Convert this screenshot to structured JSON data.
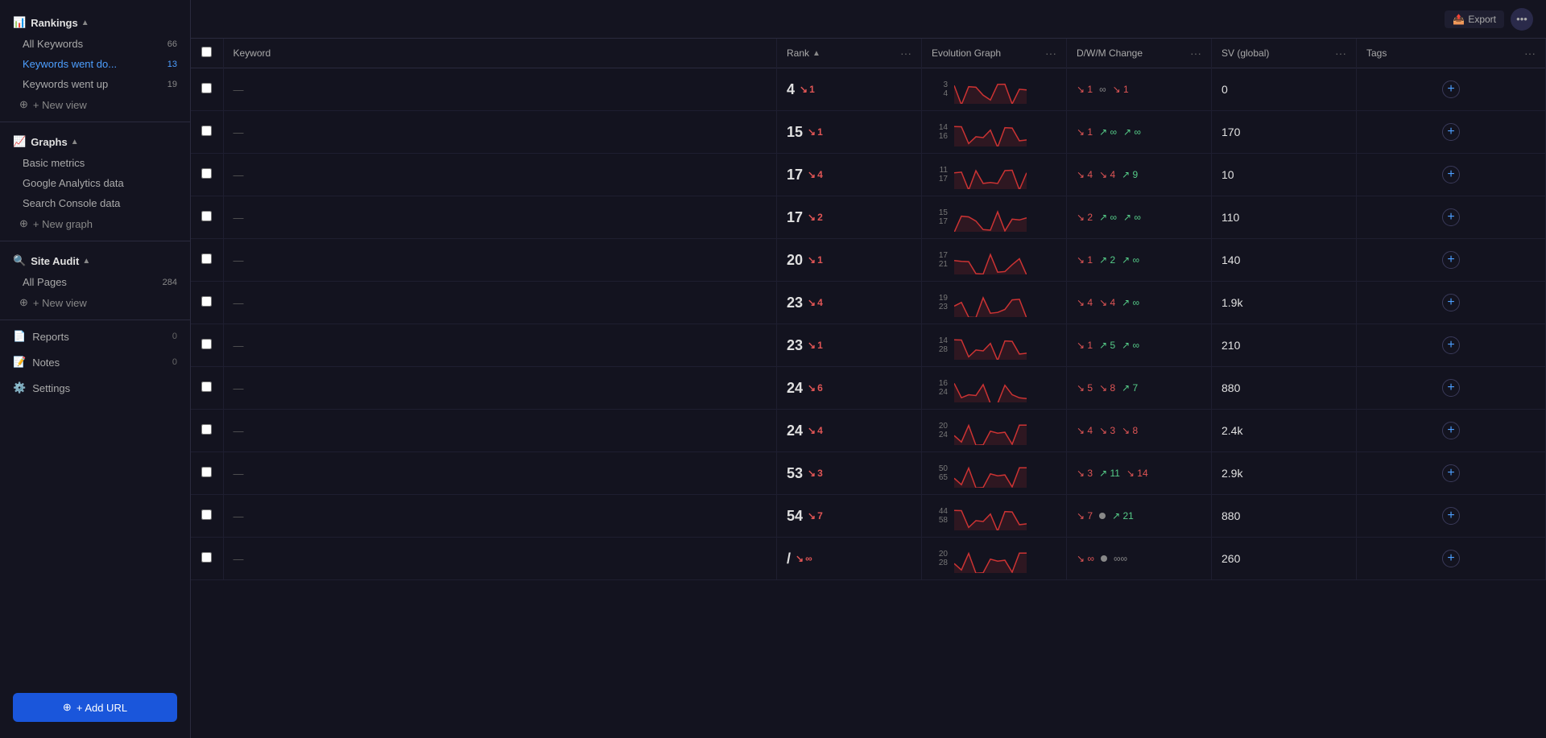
{
  "sidebar": {
    "rankings_label": "Rankings",
    "all_keywords_label": "All Keywords",
    "all_keywords_count": "66",
    "keywords_went_down_label": "Keywords went do...",
    "keywords_went_down_count": "13",
    "keywords_went_up_label": "Keywords went up",
    "keywords_went_up_count": "19",
    "new_view_label1": "+ New view",
    "graphs_label": "Graphs",
    "basic_metrics_label": "Basic metrics",
    "google_analytics_label": "Google Analytics data",
    "search_console_label": "Search Console data",
    "new_graph_label": "+ New graph",
    "site_audit_label": "Site Audit",
    "all_pages_label": "All Pages",
    "all_pages_count": "284",
    "new_view_label2": "+ New view",
    "reports_label": "Reports",
    "reports_count": "0",
    "notes_label": "Notes",
    "notes_count": "0",
    "settings_label": "Settings",
    "add_url_label": "+ Add URL"
  },
  "table": {
    "columns": {
      "rank": "Rank",
      "evolution": "Evolution Graph",
      "dwm": "D/W/M Change",
      "sv": "SV (global)",
      "tags": "Tags"
    },
    "rows": [
      {
        "id": 1,
        "rank": "4",
        "rank_change": "1",
        "rank_dir": "down",
        "evo_min": "3",
        "evo_max": "4",
        "d_val": "1",
        "d_dir": "down",
        "w_val": "∞",
        "w_dir": "neutral",
        "m_val": "1",
        "m_dir": "down",
        "sv": "0"
      },
      {
        "id": 2,
        "rank": "15",
        "rank_change": "1",
        "rank_dir": "down",
        "evo_min": "14",
        "evo_max": "16",
        "d_val": "1",
        "d_dir": "down",
        "w_val": "∞",
        "w_dir": "up",
        "m_val": "∞",
        "m_dir": "up",
        "sv": "170"
      },
      {
        "id": 3,
        "rank": "17",
        "rank_change": "4",
        "rank_dir": "down",
        "evo_min": "11",
        "evo_max": "17",
        "d_val": "4",
        "d_dir": "down",
        "w_val": "4",
        "w_dir": "down",
        "m_val": "9",
        "m_dir": "up",
        "sv": "10"
      },
      {
        "id": 4,
        "rank": "17",
        "rank_change": "2",
        "rank_dir": "down",
        "evo_min": "15",
        "evo_max": "17",
        "d_val": "2",
        "d_dir": "down",
        "w_val": "∞",
        "w_dir": "up",
        "m_val": "∞",
        "m_dir": "up",
        "sv": "110"
      },
      {
        "id": 5,
        "rank": "20",
        "rank_change": "1",
        "rank_dir": "down",
        "evo_min": "17",
        "evo_max": "21",
        "d_val": "1",
        "d_dir": "down",
        "w_val": "2",
        "w_dir": "up",
        "m_val": "∞",
        "m_dir": "up",
        "sv": "140"
      },
      {
        "id": 6,
        "rank": "23",
        "rank_change": "4",
        "rank_dir": "down",
        "evo_min": "19",
        "evo_max": "23",
        "d_val": "4",
        "d_dir": "down",
        "w_val": "4",
        "w_dir": "down",
        "m_val": "∞",
        "m_dir": "up",
        "sv": "1.9k"
      },
      {
        "id": 7,
        "rank": "23",
        "rank_change": "1",
        "rank_dir": "down",
        "evo_min": "14",
        "evo_max": "28",
        "d_val": "1",
        "d_dir": "down",
        "w_val": "5",
        "w_dir": "up",
        "m_val": "∞",
        "m_dir": "up",
        "sv": "210"
      },
      {
        "id": 8,
        "rank": "24",
        "rank_change": "6",
        "rank_dir": "down",
        "evo_min": "16",
        "evo_max": "24",
        "d_val": "5",
        "d_dir": "down",
        "w_val": "8",
        "w_dir": "down",
        "m_val": "7",
        "m_dir": "up",
        "sv": "880"
      },
      {
        "id": 9,
        "rank": "24",
        "rank_change": "4",
        "rank_dir": "down",
        "evo_min": "20",
        "evo_max": "24",
        "d_val": "4",
        "d_dir": "down",
        "w_val": "3",
        "w_dir": "down",
        "m_val": "8",
        "m_dir": "down",
        "sv": "2.4k"
      },
      {
        "id": 10,
        "rank": "53",
        "rank_change": "3",
        "rank_dir": "down",
        "evo_min": "50",
        "evo_max": "65",
        "d_val": "3",
        "d_dir": "down",
        "w_val": "11",
        "w_dir": "up",
        "m_val": "14",
        "m_dir": "down",
        "sv": "2.9k"
      },
      {
        "id": 11,
        "rank": "54",
        "rank_change": "7",
        "rank_dir": "down",
        "evo_min": "44",
        "evo_max": "58",
        "d_val": "7",
        "d_dir": "down",
        "w_val": "•",
        "w_dir": "neutral",
        "m_val": "21",
        "m_dir": "up",
        "sv": "880"
      },
      {
        "id": 12,
        "rank": "/",
        "rank_change": "∞",
        "rank_dir": "down",
        "evo_min": "20",
        "evo_max": "28",
        "d_val": "∞",
        "d_dir": "down",
        "w_val": "•",
        "w_dir": "neutral",
        "m_val": "∞∞",
        "m_dir": "neutral",
        "sv": "260"
      }
    ]
  },
  "colors": {
    "accent_blue": "#4d9fff",
    "down_red": "#e05555",
    "up_green": "#55cc88",
    "neutral_gray": "#888888",
    "bg_dark": "#13131f",
    "bg_sidebar": "#141420"
  }
}
